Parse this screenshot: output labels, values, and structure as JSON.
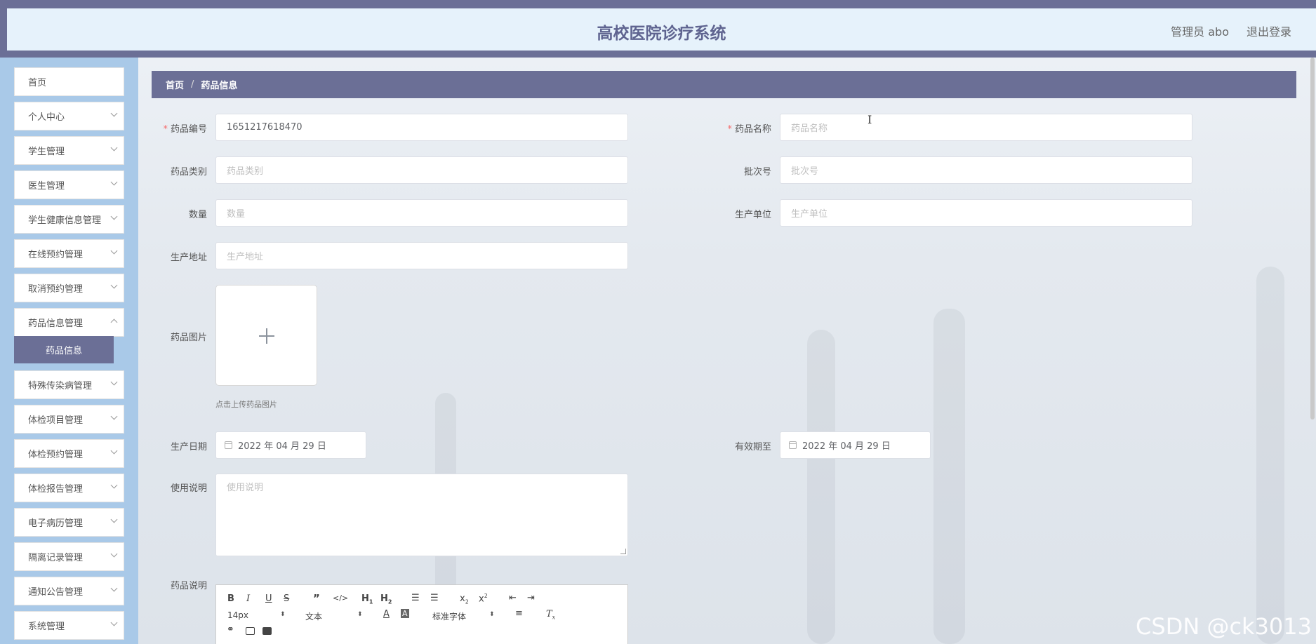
{
  "header": {
    "title": "高校医院诊疗系统",
    "admin": "管理员 abo",
    "logout": "退出登录"
  },
  "sidebar": {
    "items": [
      {
        "label": "首页"
      },
      {
        "label": "个人中心"
      },
      {
        "label": "学生管理"
      },
      {
        "label": "医生管理"
      },
      {
        "label": "学生健康信息管理"
      },
      {
        "label": "在线预约管理"
      },
      {
        "label": "取消预约管理"
      },
      {
        "label": "药品信息管理"
      },
      {
        "label": "特殊传染病管理"
      },
      {
        "label": "体检项目管理"
      },
      {
        "label": "体检预约管理"
      },
      {
        "label": "体检报告管理"
      },
      {
        "label": "电子病历管理"
      },
      {
        "label": "隔离记录管理"
      },
      {
        "label": "通知公告管理"
      },
      {
        "label": "系统管理"
      }
    ],
    "active_sub": "药品信息"
  },
  "breadcrumb": {
    "home": "首页",
    "sep": "/",
    "current": "药品信息"
  },
  "form": {
    "code": {
      "label": "药品编号",
      "value": "1651217618470"
    },
    "name": {
      "label": "药品名称",
      "placeholder": "药品名称"
    },
    "category": {
      "label": "药品类别",
      "placeholder": "药品类别"
    },
    "batch": {
      "label": "批次号",
      "placeholder": "批次号"
    },
    "quantity": {
      "label": "数量",
      "placeholder": "数量"
    },
    "manufacturer": {
      "label": "生产单位",
      "placeholder": "生产单位"
    },
    "address": {
      "label": "生产地址",
      "placeholder": "生产地址"
    },
    "image": {
      "label": "药品图片",
      "tip": "点击上传药品图片"
    },
    "production_date": {
      "label": "生产日期",
      "value": "2022 年 04 月 29 日"
    },
    "expiry_date": {
      "label": "有效期至",
      "value": "2022 年 04 月 29 日"
    },
    "usage": {
      "label": "使用说明",
      "placeholder": "使用说明"
    },
    "description": {
      "label": "药品说明"
    }
  },
  "editor": {
    "font_size": "14px",
    "block": "文本",
    "font": "标准字体"
  },
  "watermark": "CSDN @ck3013"
}
